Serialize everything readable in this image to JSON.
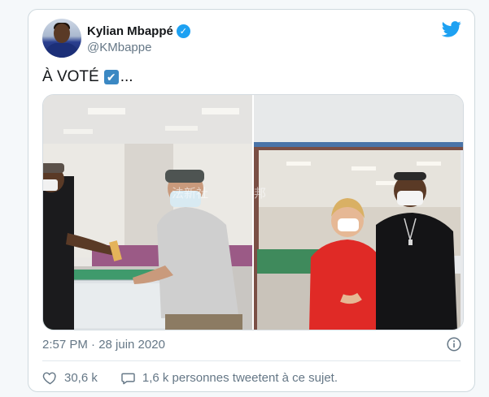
{
  "author": {
    "display_name": "Kylian Mbappé",
    "handle": "@KMbappe",
    "verified": true
  },
  "tweet": {
    "text": "À VOTÉ",
    "emoji": "✔",
    "ellipsis": "..."
  },
  "media": {
    "images": [
      {
        "name": "photo-voting-ballot-box"
      },
      {
        "name": "photo-posing-with-woman-in-red"
      }
    ]
  },
  "meta": {
    "timestamp": "2:57 PM · 28 juin 2020"
  },
  "actions": {
    "likes": "30,6 k",
    "conversation": "1,6 k personnes tweetent à ce sujet."
  },
  "colors": {
    "twitter_blue": "#1da1f2",
    "muted_text": "#657786",
    "border": "#cfd9de"
  },
  "icons": [
    "verified-badge-icon",
    "twitter-bird-icon",
    "info-icon",
    "heart-icon",
    "comment-bubble-icon"
  ]
}
